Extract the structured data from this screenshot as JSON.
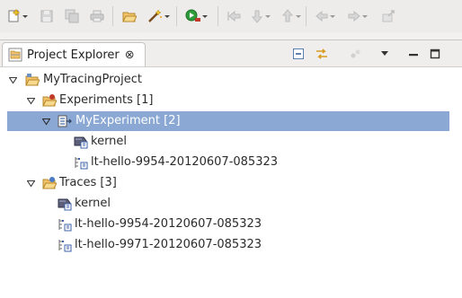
{
  "toolbar": {
    "buttons": [
      {
        "name": "new-icon",
        "enabled": true,
        "has_dropdown": true
      },
      {
        "name": "save-icon",
        "enabled": false
      },
      {
        "name": "save-all-icon",
        "enabled": false
      },
      {
        "name": "print-icon",
        "enabled": false
      },
      {
        "name": "open-folder-icon",
        "enabled": true
      },
      {
        "name": "wand-icon",
        "enabled": true,
        "has_dropdown": true
      },
      {
        "name": "run-icon",
        "enabled": true,
        "has_dropdown": true
      },
      {
        "name": "back-history-icon",
        "enabled": false
      },
      {
        "name": "next-annotation-icon",
        "enabled": false
      },
      {
        "name": "prev-annotation-icon",
        "enabled": false
      },
      {
        "name": "back-icon",
        "enabled": false,
        "has_dropdown": true
      },
      {
        "name": "forward-icon",
        "enabled": false,
        "has_dropdown": true
      },
      {
        "name": "last-edit-icon",
        "enabled": false
      }
    ]
  },
  "view": {
    "tab_label": "Project Explorer",
    "tab_close_glyph": "⊗",
    "toolbar": [
      "collapse-all-icon",
      "link-editor-icon",
      "filter-icon",
      "view-menu-icon",
      "minimize-icon",
      "maximize-icon"
    ]
  },
  "tree": {
    "project": {
      "label": "MyTracingProject",
      "expanded": true
    },
    "experiments_folder": {
      "label": "Experiments [1]",
      "expanded": true
    },
    "experiment": {
      "label": "MyExperiment [2]",
      "expanded": true,
      "selected": true
    },
    "exp_trace_kernel": {
      "label": "kernel"
    },
    "exp_trace_lthello": {
      "label": "lt-hello-9954-20120607-085323"
    },
    "traces_folder": {
      "label": "Traces [3]",
      "expanded": true
    },
    "trace_kernel": {
      "label": "kernel"
    },
    "trace_lthello_1": {
      "label": "lt-hello-9954-20120607-085323"
    },
    "trace_lthello_2": {
      "label": "lt-hello-9971-20120607-085323"
    }
  },
  "colors": {
    "selection": "#8aa8d3",
    "background": "#ffffff",
    "chrome": "#efeeed"
  }
}
